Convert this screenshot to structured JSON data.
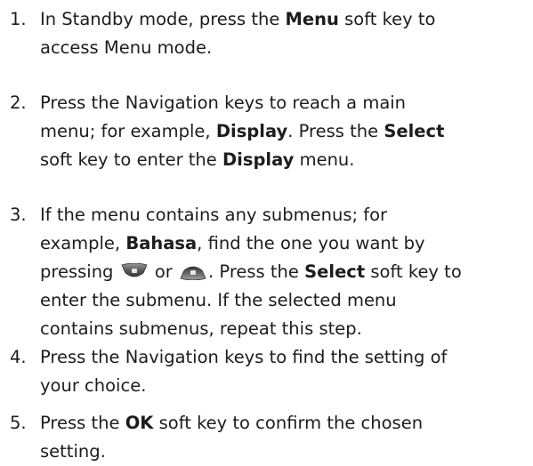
{
  "steps": [
    {
      "number": "1.",
      "line1_a": "In Standby mode, press the ",
      "line1_b": "Menu",
      "line1_c": " soft key to",
      "line2": "access Menu mode."
    },
    {
      "number": "2.",
      "line1": "Press the Navigation keys to reach a main",
      "line2_a": "menu; for example, ",
      "line2_b": "Display",
      "line2_c": ". Press the ",
      "line2_d": "Select",
      "line3_a": "soft key to enter the ",
      "line3_b": "Display",
      "line3_c": " menu."
    },
    {
      "number": "3.",
      "line1": "If the menu contains any submenus; for",
      "line2_a": "example, ",
      "line2_b": "Bahasa",
      "line2_c": ", find the one you want by",
      "line3_a": "pressing ",
      "line3_b": " or ",
      "line3_c": ". Press the ",
      "line3_d": "Select",
      "line3_e": " soft key to",
      "line4": "enter the submenu. If the selected menu",
      "line5": "contains submenus, repeat this step."
    },
    {
      "number": "4.",
      "line1": "Press the Navigation keys to find the setting of",
      "line2": "your choice."
    },
    {
      "number": "5.",
      "line1_a": "Press the ",
      "line1_b": "OK",
      "line1_c": " soft key to confirm the chosen",
      "line2": "setting."
    }
  ],
  "icons": {
    "down_key": "nav-down-key-icon",
    "up_key": "nav-up-key-icon"
  }
}
